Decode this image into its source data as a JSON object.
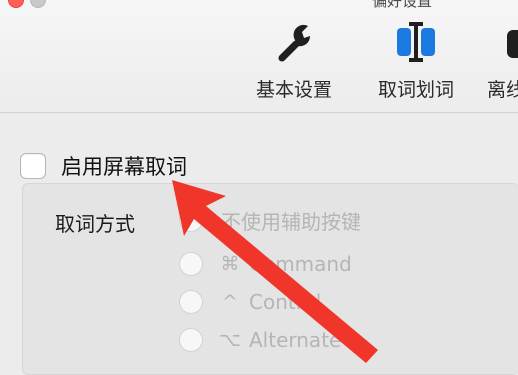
{
  "window": {
    "title": "偏好设置"
  },
  "toolbar": {
    "tabs": [
      {
        "label": "基本设置",
        "icon": "wrench-icon"
      },
      {
        "label": "取词划词",
        "icon": "text-cursor-icon"
      },
      {
        "label": "离线",
        "icon": "partial-icon"
      }
    ]
  },
  "settings": {
    "enable_label": "启用屏幕取词",
    "enable_checked": false,
    "method_label": "取词方式",
    "options": [
      {
        "glyph": "",
        "label": "不使用辅助按键"
      },
      {
        "glyph": "⌘",
        "label": "Command"
      },
      {
        "glyph": "^",
        "label": "Control"
      },
      {
        "glyph": "⌥",
        "label": "Alternate"
      }
    ]
  },
  "colors": {
    "annotation_arrow": "#f0352b",
    "accent_icon": "#1a7ae0",
    "disabled_text": "#b5b5b5"
  }
}
